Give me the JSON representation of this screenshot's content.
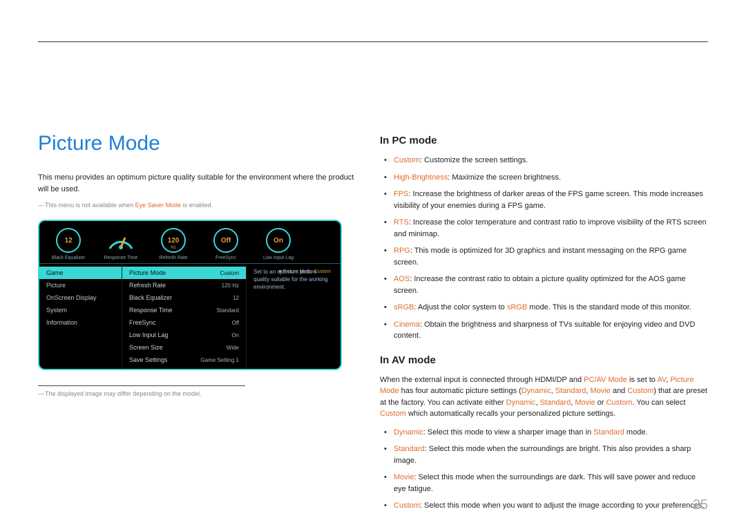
{
  "page_number": "25",
  "title": "Picture Mode",
  "intro": "This menu provides an optimum picture quality suitable for the environment where the product will be used.",
  "footnote1_pre": "This menu is not available when ",
  "footnote1_hl": "Eye Saver Mode",
  "footnote1_post": " is enabled.",
  "footnote2": "The displayed image may differ depending on the model.",
  "osd": {
    "dials": [
      {
        "value": "12",
        "sub": "",
        "label": "Black Equalizer",
        "type": "dial"
      },
      {
        "value": "",
        "sub": "",
        "label": "Response Time",
        "type": "gauge"
      },
      {
        "value": "120",
        "sub": "Hz",
        "label": "Refresh Rate",
        "type": "dial"
      },
      {
        "value": "Off",
        "sub": "",
        "label": "FreeSync",
        "type": "dial"
      },
      {
        "value": "On",
        "sub": "",
        "label": "Low Input Lag",
        "type": "dial"
      }
    ],
    "status_label": "Picture Mode:",
    "status_value": "Custom",
    "left_menu": [
      "Game",
      "Picture",
      "OnScreen Display",
      "System",
      "Information"
    ],
    "left_selected": 0,
    "center_menu": [
      {
        "label": "Picture Mode",
        "value": "Custom",
        "sel": true
      },
      {
        "label": "Refresh Rate",
        "value": "120 Hz"
      },
      {
        "label": "Black Equalizer",
        "value": "12"
      },
      {
        "label": "Response Time",
        "value": "Standard"
      },
      {
        "label": "FreeSync",
        "value": "Off"
      },
      {
        "label": "Low Input Lag",
        "value": "On"
      },
      {
        "label": "Screen Size",
        "value": "Wide"
      },
      {
        "label": "Save Settings",
        "value": "Game Setting 1"
      }
    ],
    "desc": "Set to an optimum picture quality suitable for the working environment."
  },
  "pc_heading": "In PC mode",
  "pc_items": [
    {
      "hl": "Custom",
      "text": ": Customize the screen settings."
    },
    {
      "hl": "High-Brightness",
      "text": ": Maximize the screen brightness."
    },
    {
      "hl": "FPS",
      "text": ": Increase the brightness of darker areas of the FPS game screen. This mode increases visibility of your enemies during a FPS game."
    },
    {
      "hl": "RTS",
      "text": ": Increase the color temperature and contrast ratio to improve visibility of the RTS screen and minimap."
    },
    {
      "hl": "RPG",
      "text": ": This mode is optimized for 3D graphics and instant messaging on the RPG game screen."
    },
    {
      "hl": "AOS",
      "text": ": Increase the contrast ratio to obtain a picture quality optimized for the AOS game screen."
    },
    {
      "hl": "sRGB",
      "pre": ": Adjust the color system to ",
      "mid_hl": "sRGB",
      "post": " mode. This is the standard mode of this monitor."
    },
    {
      "hl": "Cinema",
      "text": ": Obtain the brightness and sharpness of TVs suitable for enjoying video and DVD content."
    }
  ],
  "av_heading": "In AV mode",
  "av_intro": {
    "p1": "When the external input is connected through HDMI/DP and ",
    "h1": "PC/AV Mode",
    "p2": " is set to ",
    "h2": "AV",
    "p3": ", ",
    "h3": "Picture Mode",
    "p4": " has four automatic picture settings (",
    "h4": "Dynamic",
    "p5": ", ",
    "h5": "Standard",
    "p6": ", ",
    "h6": "Movie",
    "p7": " and ",
    "h7": "Custom",
    "p8": ") that are preset at the factory. You can activate either ",
    "h8": "Dynamic",
    "p9": ", ",
    "h9": "Standard",
    "p10": ", ",
    "h10": "Movie",
    "p11": " or ",
    "h11": "Custom",
    "p12": ". You can select ",
    "h12": "Custom",
    "p13": " which automatically recalls your personalized picture settings."
  },
  "av_items": [
    {
      "hl": "Dynamic",
      "pre": ": Select this mode to view a sharper image than in ",
      "mid_hl": "Standard",
      "post": " mode."
    },
    {
      "hl": "Standard",
      "text": ": Select this mode when the surroundings are bright. This also provides a sharp image."
    },
    {
      "hl": "Movie",
      "text": ": Select this mode when the surroundings are dark. This will save power and reduce eye fatigue."
    },
    {
      "hl": "Custom",
      "text": ": Select this mode when you want to adjust the image according to your preferences."
    }
  ]
}
